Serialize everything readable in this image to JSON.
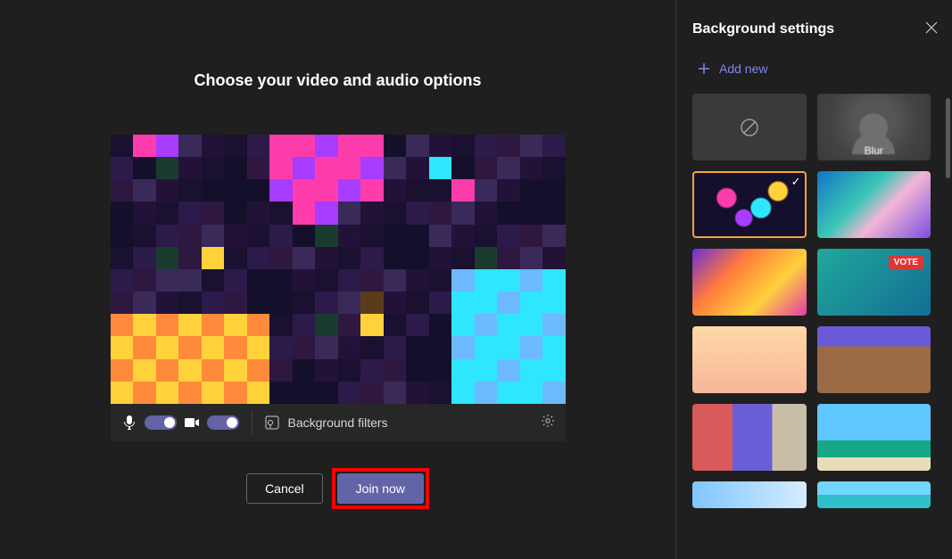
{
  "main": {
    "title": "Choose your video and audio options",
    "background_filters_label": "Background filters",
    "cancel_label": "Cancel",
    "join_label": "Join now"
  },
  "panel": {
    "title": "Background settings",
    "add_new_label": "Add new",
    "blur_label": "Blur"
  },
  "toggles": {
    "mic_on": true,
    "camera_on": true
  },
  "backgrounds": [
    {
      "id": "none",
      "name": "none-icon"
    },
    {
      "id": "blur",
      "name": "blur"
    },
    {
      "id": "lights",
      "name": "bokeh-lights",
      "selected": true
    },
    {
      "id": "wave",
      "name": "abstract-wave"
    },
    {
      "id": "hands",
      "name": "abstract-hands"
    },
    {
      "id": "vote",
      "name": "vote"
    },
    {
      "id": "cake",
      "name": "celebration-cake"
    },
    {
      "id": "room",
      "name": "living-room"
    },
    {
      "id": "office",
      "name": "office-shelves"
    },
    {
      "id": "beach",
      "name": "tropical-beach"
    },
    {
      "id": "sky",
      "name": "sky-gradient"
    },
    {
      "id": "lagoon",
      "name": "lagoon"
    }
  ]
}
